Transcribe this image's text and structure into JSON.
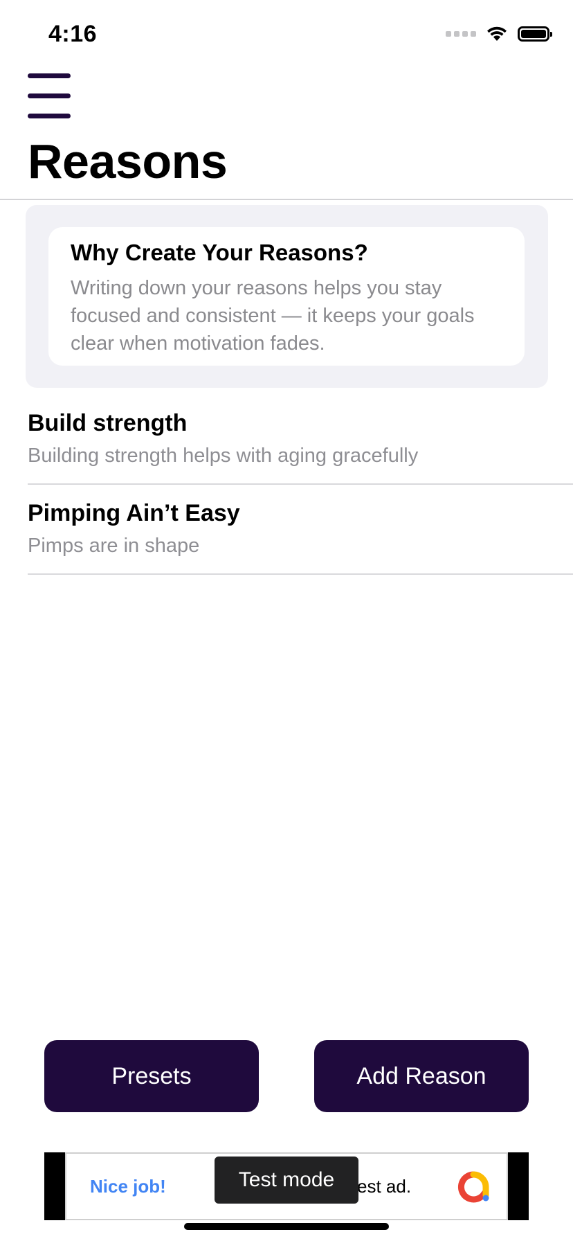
{
  "status_bar": {
    "time": "4:16",
    "icons": [
      "cellular-signal-icon",
      "wifi-icon",
      "battery-icon"
    ]
  },
  "header": {
    "menu_icon": "hamburger-menu-icon",
    "title": "Reasons"
  },
  "info_card": {
    "title": "Why Create Your Reasons?",
    "body": "Writing down your reasons helps you stay focused and consistent — it keeps your goals clear when motivation fades."
  },
  "reasons": [
    {
      "title": "Build strength",
      "subtitle": "Building strength helps with aging gracefully"
    },
    {
      "title": "Pimping Ain’t Easy",
      "subtitle": "Pimps are in shape"
    }
  ],
  "actions": {
    "presets_label": "Presets",
    "add_reason_label": "Add Reason"
  },
  "ad_banner": {
    "left_text": "Nice job!",
    "right_text": "est ad.",
    "overlay_text": "Test mode",
    "logo_icon": "adsense-logo-icon"
  },
  "colors": {
    "accent": "#1f0a3d",
    "secondary_text": "#8e8e93",
    "card_background": "#f1f1f6",
    "ad_link": "#4285f4"
  }
}
